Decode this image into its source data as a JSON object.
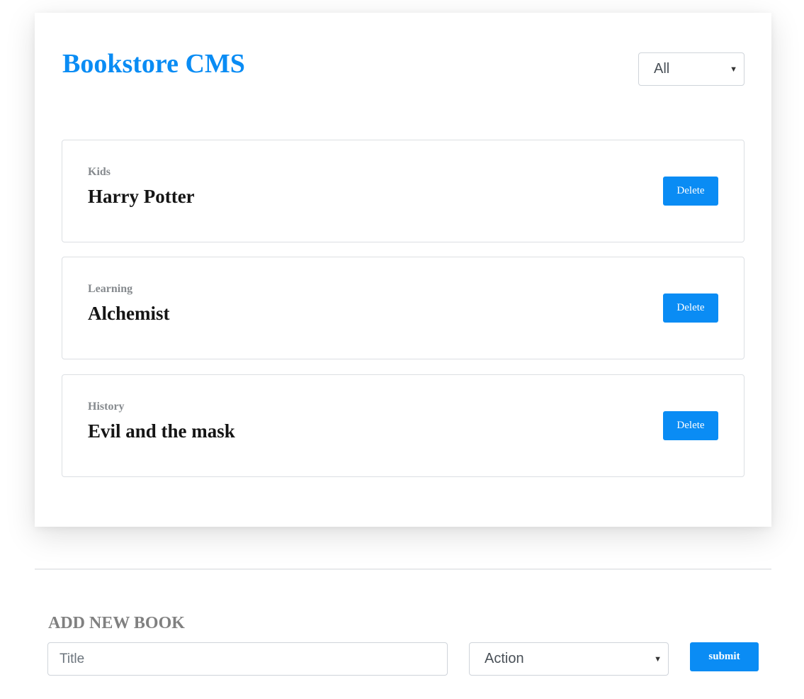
{
  "header": {
    "title": "Bookstore CMS",
    "filter": {
      "selected": "All"
    }
  },
  "books": [
    {
      "category": "Kids",
      "title": "Harry Potter",
      "delete_label": "Delete"
    },
    {
      "category": "Learning",
      "title": "Alchemist",
      "delete_label": "Delete"
    },
    {
      "category": "History",
      "title": "Evil and the mask",
      "delete_label": "Delete"
    }
  ],
  "form": {
    "heading": "ADD NEW BOOK",
    "title_placeholder": "Title",
    "category_selected": "Action",
    "submit_label": "submit"
  },
  "colors": {
    "accent": "#0a8cf4",
    "muted_text": "#868a8e",
    "heading_gray": "#808080"
  }
}
